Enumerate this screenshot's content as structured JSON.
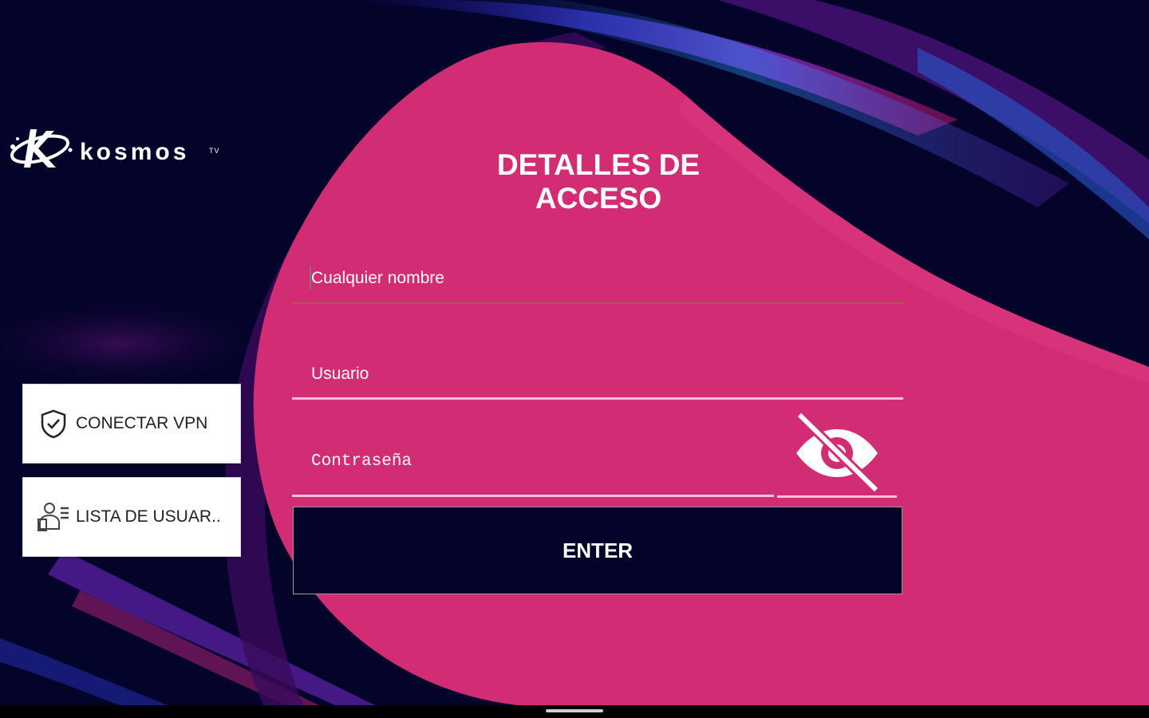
{
  "brand": {
    "name": "kosmos",
    "suffix": "TV"
  },
  "sidebar": {
    "vpn_button": {
      "label": "CONECTAR VPN",
      "icon": "shield-check-icon"
    },
    "users_button": {
      "label": "LISTA DE USUAR..",
      "icon": "user-list-icon"
    }
  },
  "login": {
    "title": "DETALLES DE ACCESO",
    "fields": {
      "name_placeholder": "Cualquier nombre",
      "user_placeholder": "Usuario",
      "password_placeholder": "Contraseña",
      "password_toggle_icon": "eye-off-icon"
    },
    "enter_label": "ENTER"
  },
  "colors": {
    "background": "#04032a",
    "panel": "#d22d74",
    "button_dark": "#04032a",
    "text": "#ffffff"
  }
}
